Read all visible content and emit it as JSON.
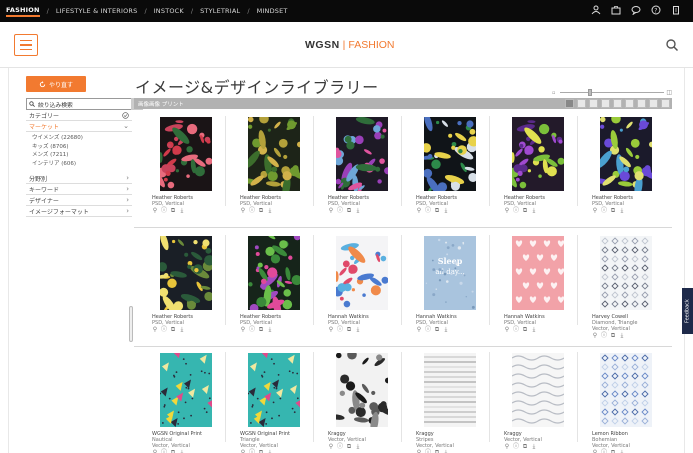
{
  "topnav": {
    "items": [
      "FASHION",
      "LIFESTYLE & INTERIORS",
      "INSTOCK",
      "STYLETRIAL",
      "MINDSET"
    ],
    "separator": "/",
    "icons": [
      "user-icon",
      "briefcase-icon",
      "chat-icon",
      "help-icon",
      "clipboard-icon"
    ]
  },
  "header": {
    "logo_wgsn": "WGSN",
    "logo_bar": "|",
    "logo_fashion": "FASHION",
    "menu_icon": "hamburger-icon",
    "search_icon": "search-icon"
  },
  "sidebar": {
    "reset_label": "やり直す",
    "search_label": "絞り込み検索",
    "category": "カテゴリー",
    "market": "マーケット",
    "market_items": [
      "ウイメンズ (22680)",
      "キッズ (8706)",
      "メンズ (7211)",
      "インテリア (606)"
    ],
    "field": "分野別",
    "keyword": "キーワード",
    "designer": "デザイナー",
    "image_format": "イメージフォーマット"
  },
  "main": {
    "title": "イメージ&デザインライブラリー",
    "grid_header": "画像画像 プリント",
    "feedback": "Feedback"
  },
  "rows": [
    [
      {
        "title": "Heather Roberts",
        "sub": "PSD, Vertical",
        "sub2": "",
        "pattern": "floral-dark"
      },
      {
        "title": "Heather Roberts",
        "sub": "PSD, Vertical",
        "sub2": "",
        "pattern": "leaf-dark"
      },
      {
        "title": "Heather Roberts",
        "sub": "PSD, Vertical",
        "sub2": "",
        "pattern": "purple-floral"
      },
      {
        "title": "Heather Roberts",
        "sub": "PSD, Vertical",
        "sub2": "",
        "pattern": "night-floral"
      },
      {
        "title": "Heather Roberts",
        "sub": "PSD, Vertical",
        "sub2": "",
        "pattern": "purple-lily"
      },
      {
        "title": "Heather Roberts",
        "sub": "PSD, Vertical",
        "sub2": "",
        "pattern": "blue-lily"
      }
    ],
    [
      {
        "title": "Heather Roberts",
        "sub": "PSD, Vertical",
        "sub2": "",
        "pattern": "yellow-daisy"
      },
      {
        "title": "Heather Roberts",
        "sub": "PSD, Vertical",
        "sub2": "",
        "pattern": "green-pink"
      },
      {
        "title": "Hannah Watkins",
        "sub": "PSD, Vertical",
        "sub2": "",
        "pattern": "birds-white"
      },
      {
        "title": "Hannah Watkins",
        "sub": "PSD, Vertical",
        "sub2": "",
        "pattern": "sleep-blue"
      },
      {
        "title": "Hannah Watkins",
        "sub": "PSD, Vertical",
        "sub2": "",
        "pattern": "hearts-pink"
      },
      {
        "title": "Harvey Cowell",
        "sub": "Diamond, Triangle",
        "sub2": "Vector, Vertical",
        "pattern": "geo-grey"
      }
    ],
    [
      {
        "title": "WGSN Original Print",
        "sub": "Nautical",
        "sub2": "Vector, Vertical",
        "pattern": "teal-yellow"
      },
      {
        "title": "WGSN Original Print",
        "sub": "Triangle",
        "sub2": "Vector, Vertical",
        "pattern": "teal-yellow"
      },
      {
        "title": "Kraggy",
        "sub": "Vector, Vertical",
        "sub2": "",
        "pattern": "bw-floral"
      },
      {
        "title": "Kraggy",
        "sub": "Stripes",
        "sub2": "Vector, Vertical",
        "pattern": "stripes-grey"
      },
      {
        "title": "Kraggy",
        "sub": "Vector, Vertical",
        "sub2": "",
        "pattern": "waves-grey"
      },
      {
        "title": "Lemon Ribbon",
        "sub": "Bohemian",
        "sub2": "Vector, Vertical",
        "pattern": "boho-blue"
      }
    ]
  ],
  "colors": {
    "accent": "#f27a30",
    "topbar": "#0a0a0a",
    "grid_header": "#b2b2b2",
    "feedback": "#1e2a4a"
  }
}
